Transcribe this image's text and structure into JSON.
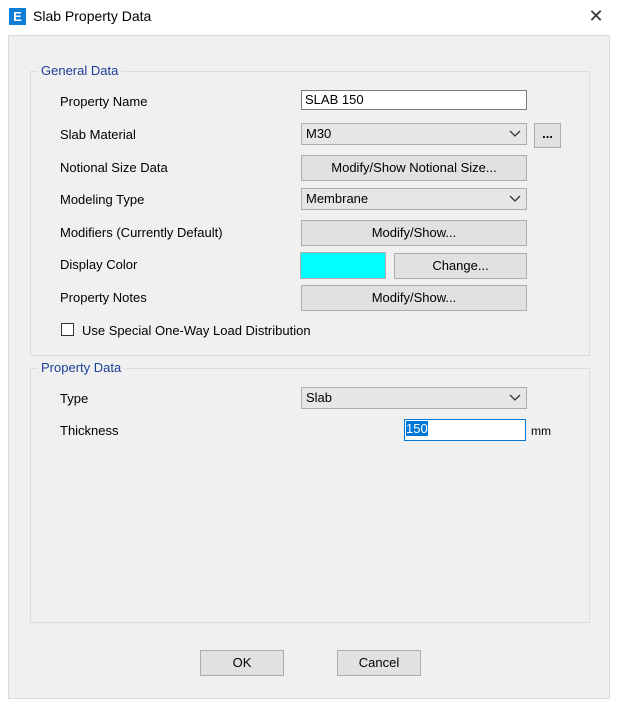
{
  "window": {
    "title": "Slab Property Data",
    "icon_letter": "E"
  },
  "general": {
    "group_title": "General Data",
    "property_name_label": "Property Name",
    "property_name_value": "SLAB 150",
    "slab_material_label": "Slab Material",
    "slab_material_value": "M30",
    "material_more_button": "...",
    "notional_label": "Notional Size Data",
    "notional_button": "Modify/Show Notional Size...",
    "modeling_type_label": "Modeling Type",
    "modeling_type_value": "Membrane",
    "modifiers_label": "Modifiers (Currently Default)",
    "modifiers_button": "Modify/Show...",
    "display_color_label": "Display Color",
    "display_color_value": "#00ffff",
    "change_button": "Change...",
    "notes_label": "Property Notes",
    "notes_button": "Modify/Show...",
    "one_way_checkbox_label": "Use Special One-Way Load Distribution",
    "one_way_checked": false
  },
  "property": {
    "group_title": "Property Data",
    "type_label": "Type",
    "type_value": "Slab",
    "thickness_label": "Thickness",
    "thickness_value": "150",
    "thickness_unit": "mm"
  },
  "footer": {
    "ok_label": "OK",
    "cancel_label": "Cancel"
  },
  "colors": {
    "group_title": "#1a3f96",
    "selection": "#0078d7",
    "swatch": "#00ffff"
  }
}
